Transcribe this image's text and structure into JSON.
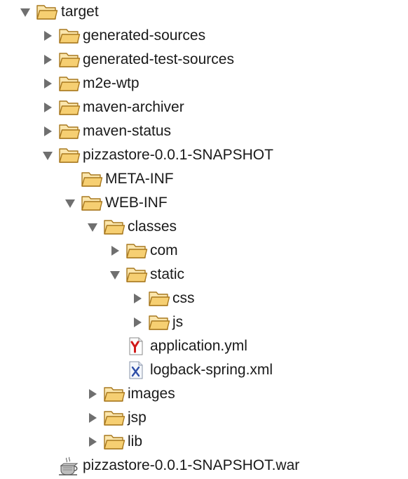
{
  "tree": {
    "items": [
      {
        "label": "target",
        "icon": "folder-icon",
        "state": "expanded"
      },
      {
        "label": "generated-sources",
        "icon": "folder-icon",
        "state": "collapsed"
      },
      {
        "label": "generated-test-sources",
        "icon": "folder-icon",
        "state": "collapsed"
      },
      {
        "label": "m2e-wtp",
        "icon": "folder-icon",
        "state": "collapsed"
      },
      {
        "label": "maven-archiver",
        "icon": "folder-icon",
        "state": "collapsed"
      },
      {
        "label": "maven-status",
        "icon": "folder-icon",
        "state": "collapsed"
      },
      {
        "label": "pizzastore-0.0.1-SNAPSHOT",
        "icon": "folder-icon",
        "state": "expanded"
      },
      {
        "label": "META-INF",
        "icon": "folder-icon",
        "state": "leaf"
      },
      {
        "label": "WEB-INF",
        "icon": "folder-icon",
        "state": "expanded"
      },
      {
        "label": "classes",
        "icon": "folder-icon",
        "state": "expanded"
      },
      {
        "label": "com",
        "icon": "folder-icon",
        "state": "collapsed"
      },
      {
        "label": "static",
        "icon": "folder-icon",
        "state": "expanded"
      },
      {
        "label": "css",
        "icon": "folder-icon",
        "state": "collapsed"
      },
      {
        "label": "js",
        "icon": "folder-icon",
        "state": "collapsed"
      },
      {
        "label": "application.yml",
        "icon": "yaml-file-icon",
        "state": "leaf"
      },
      {
        "label": "logback-spring.xml",
        "icon": "xml-file-icon",
        "state": "leaf"
      },
      {
        "label": "images",
        "icon": "folder-icon",
        "state": "collapsed"
      },
      {
        "label": "jsp",
        "icon": "folder-icon",
        "state": "collapsed"
      },
      {
        "label": "lib",
        "icon": "folder-icon",
        "state": "collapsed"
      },
      {
        "label": "pizzastore-0.0.1-SNAPSHOT.war",
        "icon": "war-archive-icon",
        "state": "leaf"
      }
    ]
  },
  "colors": {
    "folder_front": "#f6cf72",
    "folder_back": "#fbe6ad",
    "folder_outline": "#a8781e",
    "toggle": "#6f6f6f",
    "yaml_red": "#d11a1a",
    "xml_blue": "#2f4fa8"
  }
}
